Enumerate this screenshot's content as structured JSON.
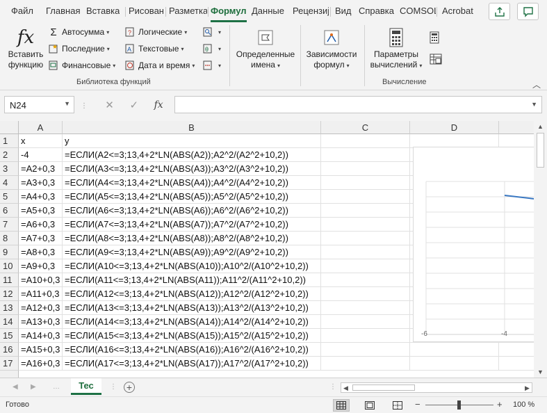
{
  "ribbon_tabs": [
    {
      "label": "Файл"
    },
    {
      "label": "Главная"
    },
    {
      "label": "Вставка"
    },
    {
      "label": "Рисован"
    },
    {
      "label": "Разметка"
    },
    {
      "label": "Формул"
    },
    {
      "label": "Данные"
    },
    {
      "label": "Рецензиј"
    },
    {
      "label": "Вид"
    },
    {
      "label": "Справка"
    },
    {
      "label": "COMSOL"
    },
    {
      "label": "Acrobat"
    }
  ],
  "active_tab": "Формул",
  "ribbon": {
    "insert_function": {
      "line1": "Вставить",
      "line2": "функцию"
    },
    "autosum": "Автосумма",
    "recent": "Последние",
    "financial": "Финансовые",
    "logical": "Логические",
    "text": "Текстовые",
    "datetime": "Дата и время",
    "defined_names": {
      "line1": "Определенные",
      "line2": "имена"
    },
    "dependencies": {
      "line1": "Зависимости",
      "line2": "формул"
    },
    "calc_options": {
      "line1": "Параметры",
      "line2": "вычислений"
    },
    "group_library": "Библиотека функций",
    "group_calc": "Вычисление"
  },
  "formula_bar": {
    "name_box": "N24",
    "fx": "fx",
    "cancel": "✕",
    "enter": "✓",
    "value": ""
  },
  "columns": [
    "A",
    "B",
    "C",
    "D"
  ],
  "rows": [
    {
      "n": "1",
      "a": "x",
      "b": "y"
    },
    {
      "n": "2",
      "a": "-4",
      "b": "=ЕСЛИ(A2<=3;13,4+2*LN(ABS(A2));A2^2/(A2^2+10,2))"
    },
    {
      "n": "3",
      "a": "=A2+0,3",
      "b": "=ЕСЛИ(A3<=3;13,4+2*LN(ABS(A3));A3^2/(A3^2+10,2))"
    },
    {
      "n": "4",
      "a": "=A3+0,3",
      "b": "=ЕСЛИ(A4<=3;13,4+2*LN(ABS(A4));A4^2/(A4^2+10,2))"
    },
    {
      "n": "5",
      "a": "=A4+0,3",
      "b": "=ЕСЛИ(A5<=3;13,4+2*LN(ABS(A5));A5^2/(A5^2+10,2))"
    },
    {
      "n": "6",
      "a": "=A5+0,3",
      "b": "=ЕСЛИ(A6<=3;13,4+2*LN(ABS(A6));A6^2/(A6^2+10,2))"
    },
    {
      "n": "7",
      "a": "=A6+0,3",
      "b": "=ЕСЛИ(A7<=3;13,4+2*LN(ABS(A7));A7^2/(A7^2+10,2))"
    },
    {
      "n": "8",
      "a": "=A7+0,3",
      "b": "=ЕСЛИ(A8<=3;13,4+2*LN(ABS(A8));A8^2/(A8^2+10,2))"
    },
    {
      "n": "9",
      "a": "=A8+0,3",
      "b": "=ЕСЛИ(A9<=3;13,4+2*LN(ABS(A9));A9^2/(A9^2+10,2))"
    },
    {
      "n": "10",
      "a": "=A9+0,3",
      "b": "=ЕСЛИ(A10<=3;13,4+2*LN(ABS(A10));A10^2/(A10^2+10,2))"
    },
    {
      "n": "11",
      "a": "=A10+0,3",
      "b": "=ЕСЛИ(A11<=3;13,4+2*LN(ABS(A11));A11^2/(A11^2+10,2))"
    },
    {
      "n": "12",
      "a": "=A11+0,3",
      "b": "=ЕСЛИ(A12<=3;13,4+2*LN(ABS(A12));A12^2/(A12^2+10,2))"
    },
    {
      "n": "13",
      "a": "=A12+0,3",
      "b": "=ЕСЛИ(A13<=3;13,4+2*LN(ABS(A13));A13^2/(A13^2+10,2))"
    },
    {
      "n": "14",
      "a": "=A13+0,3",
      "b": "=ЕСЛИ(A14<=3;13,4+2*LN(ABS(A14));A14^2/(A14^2+10,2))"
    },
    {
      "n": "15",
      "a": "=A14+0,3",
      "b": "=ЕСЛИ(A15<=3;13,4+2*LN(ABS(A15));A15^2/(A15^2+10,2))"
    },
    {
      "n": "16",
      "a": "=A15+0,3",
      "b": "=ЕСЛИ(A16<=3;13,4+2*LN(ABS(A16));A16^2/(A16^2+10,2))"
    },
    {
      "n": "17",
      "a": "=A16+0,3",
      "b": "=ЕСЛИ(A17<=3;13,4+2*LN(ABS(A17));A17^2/(A17^2+10,2))"
    }
  ],
  "chart": {
    "x_ticks": [
      "-6",
      "-4"
    ],
    "line_color": "#3a78c2"
  },
  "sheet_tab": "Тес",
  "status": {
    "ready": "Готово",
    "zoom": "100 %"
  }
}
